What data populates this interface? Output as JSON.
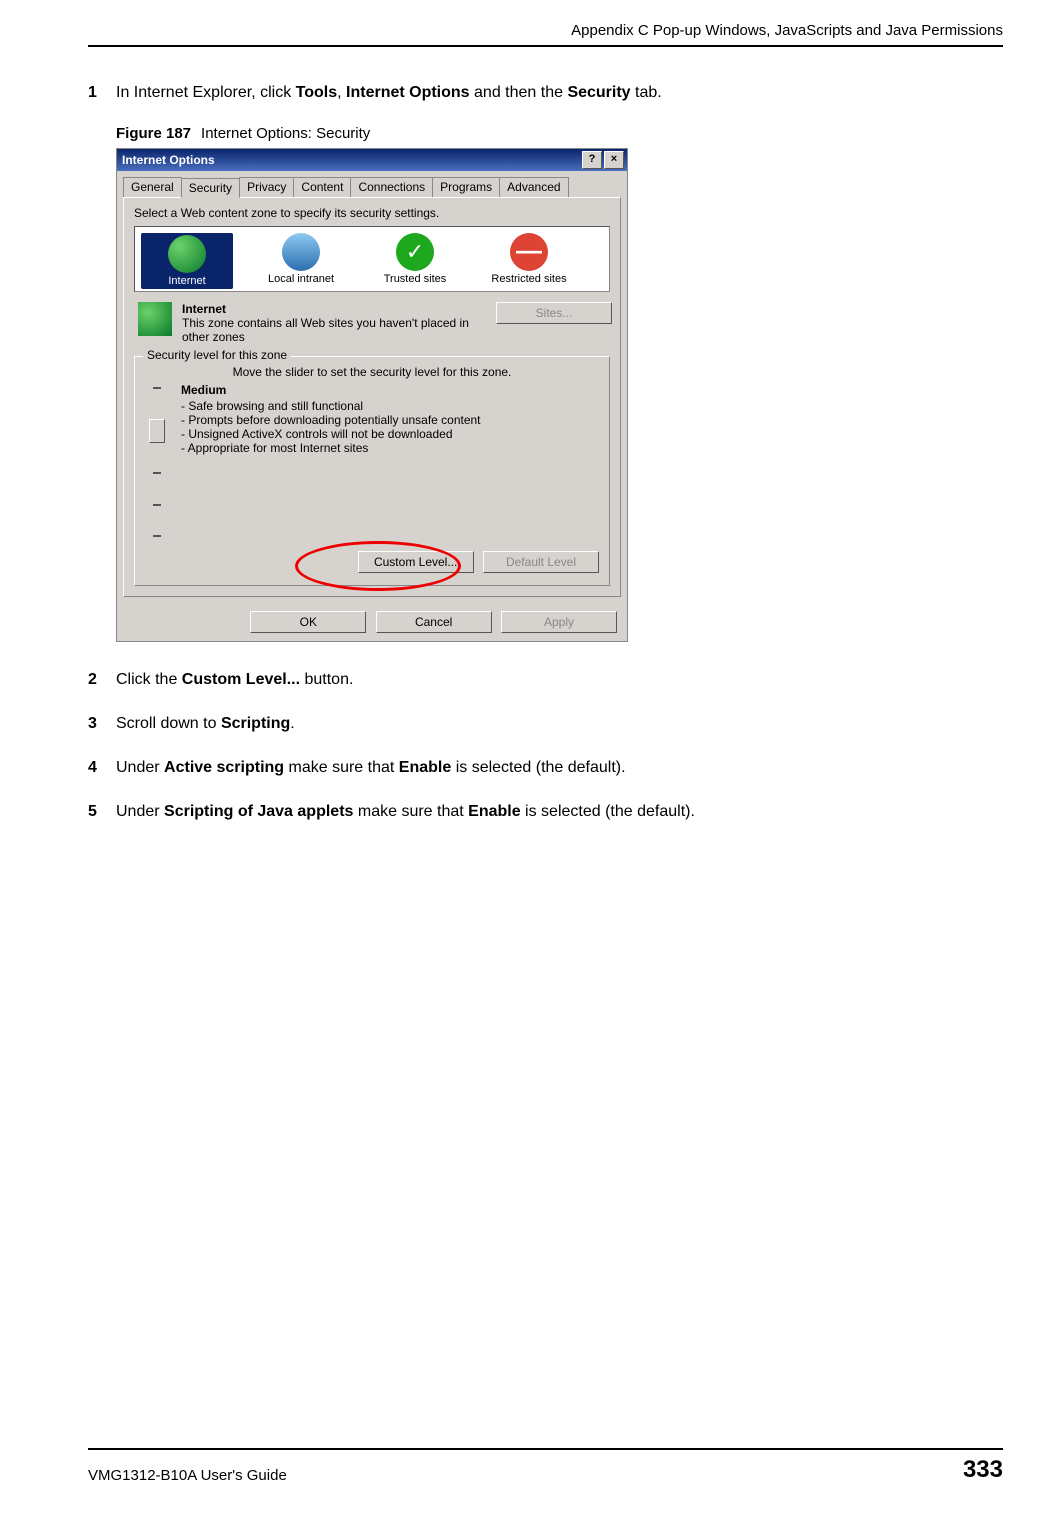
{
  "header": {
    "title": "Appendix C Pop-up Windows, JavaScripts and Java Permissions"
  },
  "steps": {
    "s1": {
      "num": "1",
      "pre": "In Internet Explorer, click ",
      "b1": "Tools",
      "mid1": ", ",
      "b2": "Internet Options",
      "mid2": " and then the ",
      "b3": "Security",
      "post": " tab."
    },
    "s2": {
      "num": "2",
      "pre": "Click the ",
      "b1": "Custom Level...",
      "post": " button."
    },
    "s3": {
      "num": "3",
      "pre": "Scroll down to ",
      "b1": "Scripting",
      "post": "."
    },
    "s4": {
      "num": "4",
      "pre": "Under ",
      "b1": "Active scripting",
      "mid1": " make sure that ",
      "b2": "Enable",
      "post": " is selected (the default)."
    },
    "s5": {
      "num": "5",
      "pre": "Under ",
      "b1": "Scripting of Java applets",
      "mid1": " make sure that ",
      "b2": "Enable",
      "post": " is selected (the default)."
    }
  },
  "figure": {
    "num": "Figure 187",
    "caption": "Internet Options: Security"
  },
  "dialog": {
    "title": "Internet Options",
    "help_btn": "?",
    "close_btn": "×",
    "tabs": [
      "General",
      "Security",
      "Privacy",
      "Content",
      "Connections",
      "Programs",
      "Advanced"
    ],
    "active_tab_index": 1,
    "zone_instruction": "Select a Web content zone to specify its security settings.",
    "zones": [
      {
        "label": "Internet",
        "selected": true
      },
      {
        "label": "Local intranet",
        "selected": false
      },
      {
        "label": "Trusted sites",
        "selected": false
      },
      {
        "label": "Restricted sites",
        "selected": false
      }
    ],
    "zone_detail": {
      "name": "Internet",
      "desc": "This zone contains all Web sites you haven't placed in other zones",
      "sites_btn": "Sites..."
    },
    "group": {
      "legend": "Security level for this zone",
      "slider_instruction": "Move the slider to set the security level for this zone.",
      "level_name": "Medium",
      "bullets": [
        "- Safe browsing and still functional",
        "- Prompts before downloading potentially unsafe content",
        "- Unsigned ActiveX controls will not be downloaded",
        "- Appropriate for most Internet sites"
      ],
      "custom_btn": "Custom Level...",
      "default_btn": "Default Level"
    },
    "buttons": {
      "ok": "OK",
      "cancel": "Cancel",
      "apply": "Apply"
    }
  },
  "footer": {
    "guide": "VMG1312-B10A User's Guide",
    "page": "333"
  }
}
